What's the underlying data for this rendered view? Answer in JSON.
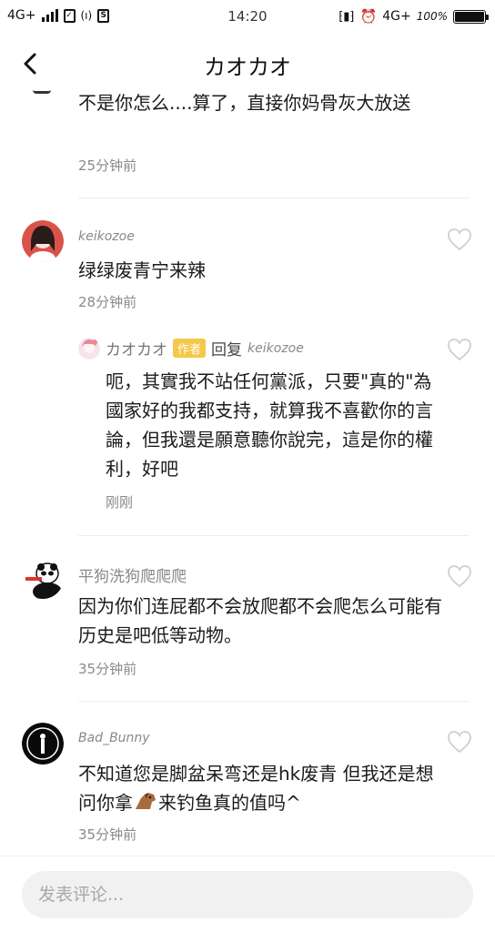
{
  "status_bar": {
    "network_left": "4G+",
    "time": "14:20",
    "network_right": "4G+",
    "battery": "100%",
    "battery_level": 1.0
  },
  "header": {
    "title": "カオカオ"
  },
  "comments": [
    {
      "body": "不是你怎么....算了，直接你妈骨灰大放送",
      "time": "25分钟前"
    },
    {
      "author": "keikozoe",
      "body": "绿绿废青宁来辣",
      "time": "28分钟前",
      "reply": {
        "author": "カオカオ",
        "tag": "作者",
        "verb": "回复",
        "target": "keikozoe",
        "body": "呃，其實我不站任何黨派，只要\"真的\"為國家好的我都支持，就算我不喜歡你的言論，但我還是願意聽你說完，這是你的權利，好吧",
        "time": "刚刚"
      }
    },
    {
      "author": "平狗洗狗爬爬爬",
      "body": "因为你们连屁都不会放爬都不会爬怎么可能有历史是吧低等动物。",
      "time": "35分钟前"
    },
    {
      "author": "Bad_Bunny",
      "body_before": "不知道您是脚盆呆弯还是hk废青 但我还是想问你拿",
      "body_after": "来钓鱼真的值吗^",
      "time": "35分钟前"
    }
  ],
  "input": {
    "placeholder": "发表评论..."
  },
  "icons": {
    "back": "chevron-left-icon",
    "like": "heart-outline-icon",
    "emoji": "horse-emoji-icon"
  }
}
